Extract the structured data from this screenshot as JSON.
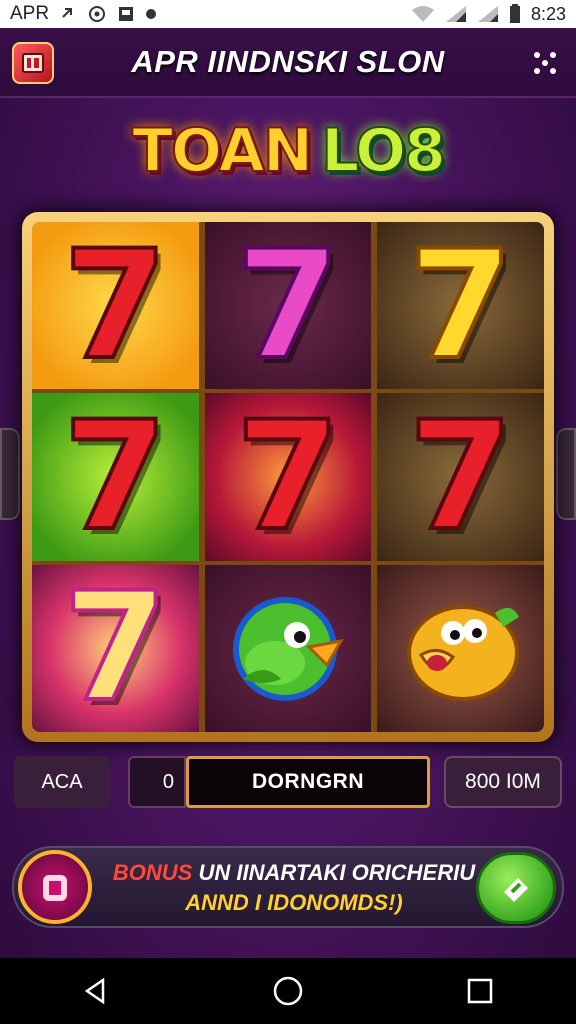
{
  "status_bar": {
    "carrier": "APR",
    "time": "8:23",
    "icons": [
      "link-icon",
      "sync-icon",
      "image-icon",
      "dot-icon",
      "wifi-icon",
      "signal-icon",
      "signal-icon",
      "battery-icon"
    ]
  },
  "header": {
    "title": "APR IINDNSKI SLON",
    "logo_icon": "game-logo-icon",
    "menu_icon": "grid-menu-icon"
  },
  "game_title": {
    "part_a": "TOAN",
    "part_b": "LO8"
  },
  "reels": [
    [
      {
        "symbol": "7",
        "style": "red",
        "bg": "orange"
      },
      {
        "symbol": "7",
        "style": "red",
        "bg": "green"
      },
      {
        "symbol": "7",
        "style": "pale",
        "bg": "burst"
      }
    ],
    [
      {
        "symbol": "7",
        "style": "pink",
        "bg": "dark"
      },
      {
        "symbol": "7",
        "style": "red",
        "bg": "red"
      },
      {
        "symbol": "bird",
        "style": "green-bird",
        "bg": "dark"
      }
    ],
    [
      {
        "symbol": "7",
        "style": "yellow",
        "bg": "olive"
      },
      {
        "symbol": "7",
        "style": "red",
        "bg": "olive"
      },
      {
        "symbol": "bird",
        "style": "yellow-bird",
        "bg": "dusk"
      }
    ]
  ],
  "controls": {
    "left_label": "ACA",
    "count": "0",
    "display": "DORNGRN",
    "right_label": "800 I0M"
  },
  "bonus": {
    "word": "BONUS",
    "line1": " UN IINARTAKI ORICHERIU",
    "line2": "ANND I IDONOMDS!)"
  },
  "colors": {
    "background": "#4a1560",
    "frame_gold": "#f7d27a",
    "accent_green": "#2ea01a",
    "bonus_red": "#ff4a3a"
  }
}
